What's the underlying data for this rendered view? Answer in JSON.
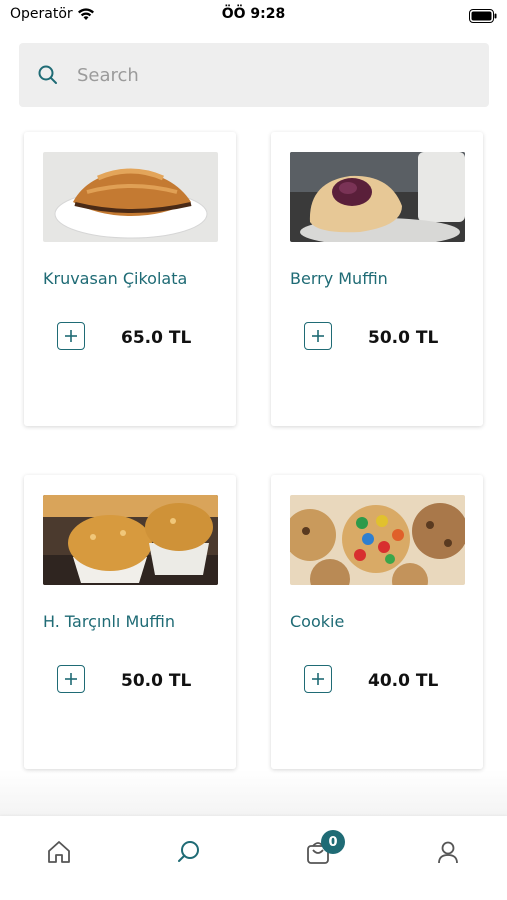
{
  "status_bar": {
    "carrier": "Operatör",
    "time": "ÖÖ 9:28"
  },
  "search": {
    "placeholder": "Search",
    "value": ""
  },
  "products": [
    {
      "name": "Kruvasan Çikolata",
      "price": "65.0 TL",
      "image": "croissant-image"
    },
    {
      "name": "Berry Muffin",
      "price": "50.0 TL",
      "image": "berry-muffin-image"
    },
    {
      "name": "H. Tarçınlı Muffin",
      "price": "50.0 TL",
      "image": "cinnamon-muffin-image"
    },
    {
      "name": "Cookie",
      "price": "40.0 TL",
      "image": "cookie-image"
    }
  ],
  "bottom_nav": {
    "items": [
      {
        "icon": "home-icon",
        "active": false
      },
      {
        "icon": "search-icon",
        "active": true
      },
      {
        "icon": "cart-icon",
        "active": false
      },
      {
        "icon": "profile-icon",
        "active": false
      }
    ],
    "cart_count": "0"
  },
  "colors": {
    "accent": "#1f6b75",
    "search_bg": "#eeeeee",
    "nav_inactive": "#555555"
  }
}
